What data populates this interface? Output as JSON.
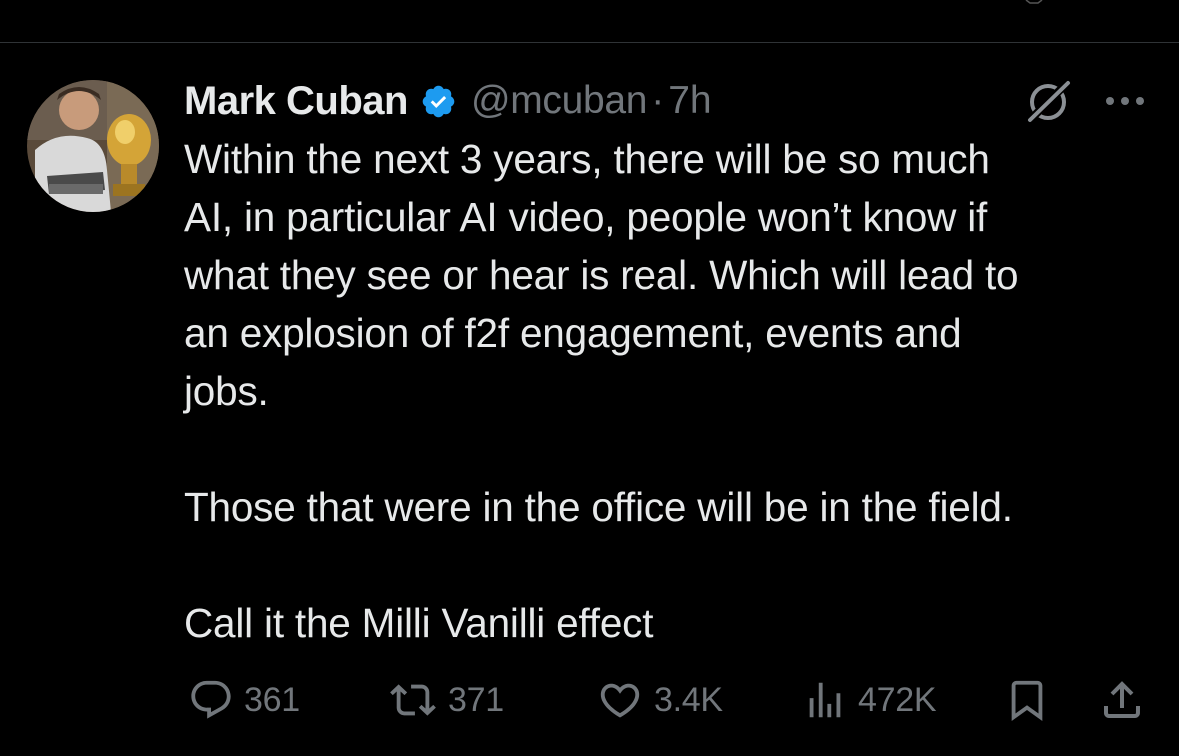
{
  "tweet": {
    "author": {
      "name": "Mark Cuban",
      "handle": "@mcuban",
      "verified": true
    },
    "separator": "·",
    "time": "7h",
    "paragraphs": [
      "Within the next 3 years, there will be so much\nAI, in particular AI video, people won’t know if\nwhat they see or hear is real.  Which will lead to\nan explosion of f2f engagement, events and\njobs.",
      "Those that were in the office will be in the field.",
      "Call it the Milli Vanilli effect"
    ],
    "stats": {
      "replies": "361",
      "reposts": "371",
      "likes": "3.4K",
      "views": "472K"
    }
  },
  "icons": {
    "verified": "verified-badge-icon",
    "grok": "grok-icon",
    "more": "more-dots-icon",
    "reply": "reply-icon",
    "repost": "repost-icon",
    "like": "heart-icon",
    "views": "views-chart-icon",
    "bookmark": "bookmark-icon",
    "share": "share-icon"
  },
  "colors": {
    "background": "#000000",
    "text_primary": "#e7e9ea",
    "text_secondary": "#71767b",
    "verified_blue": "#1d9bf0",
    "divider": "#2f3336"
  }
}
